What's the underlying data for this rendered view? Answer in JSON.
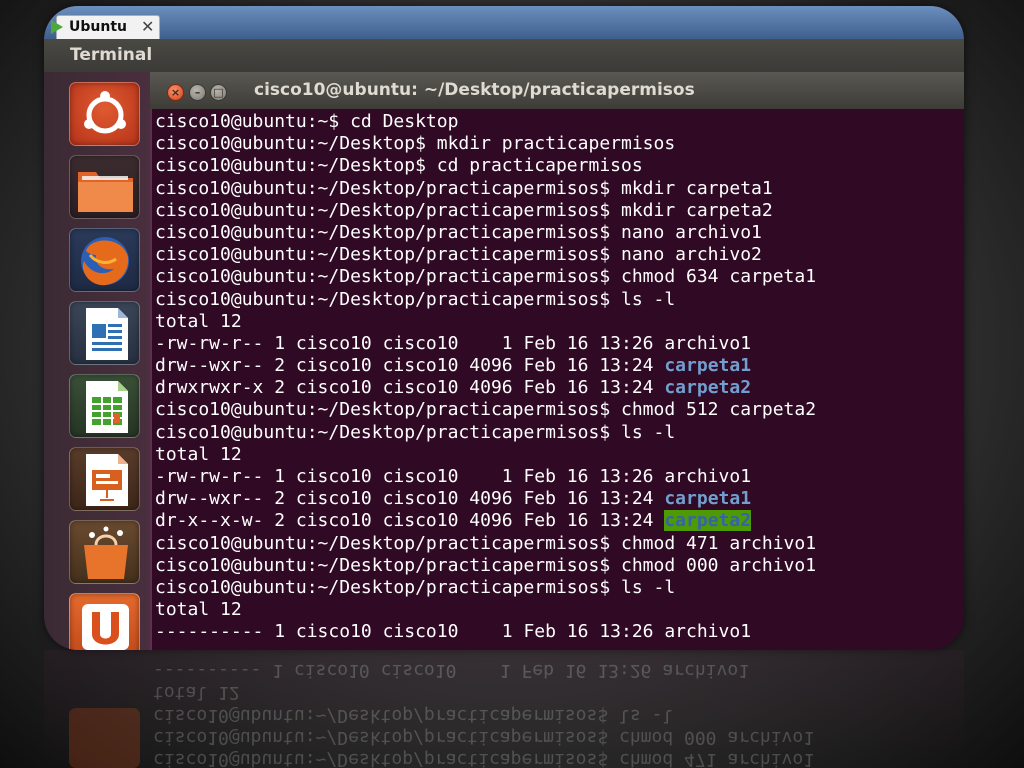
{
  "browser": {
    "tab_label": "Ubuntu",
    "tab_close": "✕"
  },
  "app": {
    "title": "Terminal"
  },
  "launcher": {
    "items": [
      {
        "name": "ubuntu-home-icon"
      },
      {
        "name": "files-folder-icon"
      },
      {
        "name": "firefox-icon"
      },
      {
        "name": "libreoffice-writer-icon"
      },
      {
        "name": "libreoffice-calc-icon"
      },
      {
        "name": "libreoffice-impress-icon"
      },
      {
        "name": "software-center-icon"
      },
      {
        "name": "ubuntu-one-icon"
      }
    ]
  },
  "window": {
    "title": "cisco10@ubuntu: ~/Desktop/practicapermisos"
  },
  "colors": {
    "terminal_bg": "#300a24",
    "directory": "#729fcf",
    "highlight_bg": "#4e9a06",
    "close_button": "#e2542a"
  },
  "terminal": {
    "lines": [
      "cisco10@ubuntu:~$ cd Desktop",
      "cisco10@ubuntu:~/Desktop$ mkdir practicapermisos",
      "cisco10@ubuntu:~/Desktop$ cd practicapermisos",
      "cisco10@ubuntu:~/Desktop/practicapermisos$ mkdir carpeta1",
      "cisco10@ubuntu:~/Desktop/practicapermisos$ mkdir carpeta2",
      "cisco10@ubuntu:~/Desktop/practicapermisos$ nano archivo1",
      "cisco10@ubuntu:~/Desktop/practicapermisos$ nano archivo2",
      "cisco10@ubuntu:~/Desktop/practicapermisos$ chmod 634 carpeta1",
      "cisco10@ubuntu:~/Desktop/practicapermisos$ ls -l",
      "total 12",
      "-rw-rw-r-- 1 cisco10 cisco10    1 Feb 16 13:26 archivo1",
      {
        "prefix": "drw--wxr-- 2 cisco10 cisco10 4096 Feb 16 13:24 ",
        "dir": "carpeta1"
      },
      {
        "prefix": "drwxrwxr-x 2 cisco10 cisco10 4096 Feb 16 13:24 ",
        "dir": "carpeta2"
      },
      "cisco10@ubuntu:~/Desktop/practicapermisos$ chmod 512 carpeta2",
      "cisco10@ubuntu:~/Desktop/practicapermisos$ ls -l",
      "total 12",
      "-rw-rw-r-- 1 cisco10 cisco10    1 Feb 16 13:26 archivo1",
      {
        "prefix": "drw--wxr-- 2 cisco10 cisco10 4096 Feb 16 13:24 ",
        "dir": "carpeta1"
      },
      {
        "prefix": "dr-x--x-w- 2 cisco10 cisco10 4096 Feb 16 13:24 ",
        "dirhl": "carpeta2"
      },
      "cisco10@ubuntu:~/Desktop/practicapermisos$ chmod 471 archivo1",
      "cisco10@ubuntu:~/Desktop/practicapermisos$ chmod 000 archivo1",
      "cisco10@ubuntu:~/Desktop/practicapermisos$ ls -l",
      "total 12",
      "---------- 1 cisco10 cisco10    1 Feb 16 13:26 archivo1"
    ]
  }
}
